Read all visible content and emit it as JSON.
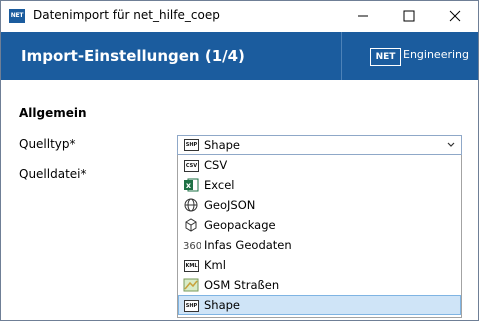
{
  "window": {
    "title": "Datenimport für net_hilfe_coep",
    "app_icon_text": "NET"
  },
  "banner": {
    "title": "Import-Einstellungen (1/4)",
    "logo_text": "NET",
    "logo_caption": "Engineering"
  },
  "form": {
    "section_title": "Allgemein",
    "quelltyp_label": "Quelltyp*",
    "quelldatei_label": "Quelldatei*",
    "selected_value": "Shape"
  },
  "dropdown": {
    "items": [
      {
        "label": "CSV",
        "icon": "csv-icon"
      },
      {
        "label": "Excel",
        "icon": "excel-icon"
      },
      {
        "label": "GeoJSON",
        "icon": "geojson-icon"
      },
      {
        "label": "Geopackage",
        "icon": "geopackage-icon"
      },
      {
        "label": "Infas Geodaten",
        "icon": "infas-360-icon"
      },
      {
        "label": "Kml",
        "icon": "kml-icon"
      },
      {
        "label": "OSM Straßen",
        "icon": "osm-map-icon"
      },
      {
        "label": "Shape",
        "icon": "shape-icon",
        "selected": true
      }
    ]
  },
  "colors": {
    "brand_blue": "#1b5c9e",
    "selection": "#cfe4f7",
    "selection_border": "#7fb4e3"
  }
}
